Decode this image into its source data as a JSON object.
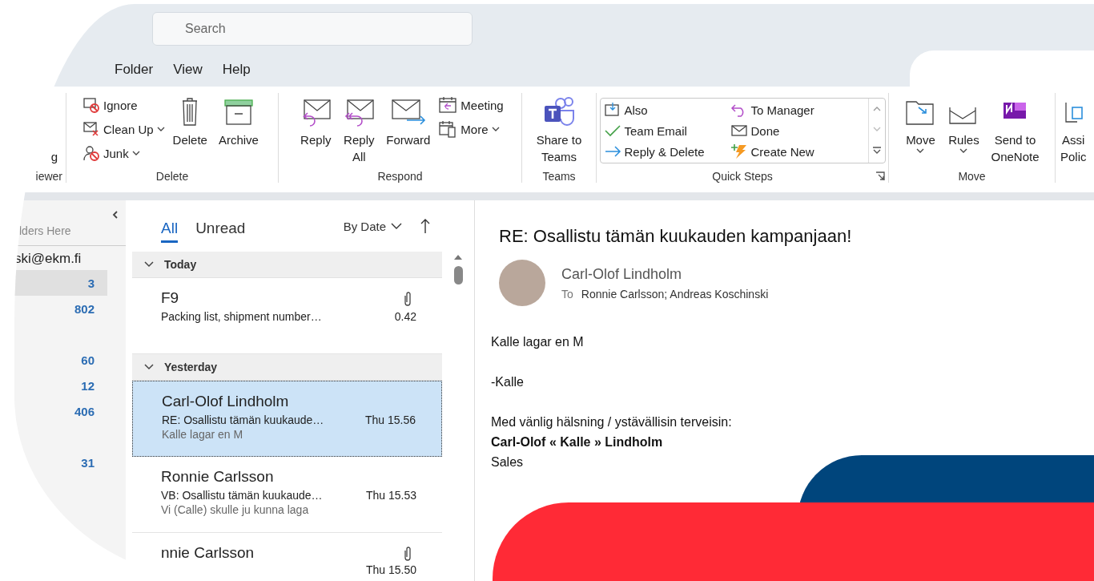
{
  "search": {
    "placeholder": "Search"
  },
  "menu": [
    {
      "label": "Folder"
    },
    {
      "label": "View"
    },
    {
      "label": "Help"
    }
  ],
  "ribbon": {
    "groups": [
      {
        "label": "iewer",
        "items": [
          {
            "kind": "stub",
            "label": "g"
          }
        ]
      },
      {
        "label": "Delete",
        "items": [
          {
            "kind": "stack",
            "items": [
              {
                "label": "Ignore",
                "dropdown": false
              },
              {
                "label": "Clean Up",
                "dropdown": true
              },
              {
                "label": "Junk",
                "dropdown": true
              }
            ]
          },
          {
            "kind": "large",
            "label": "Delete",
            "dropdown": false
          },
          {
            "kind": "large",
            "label": "Archive",
            "dropdown": false
          }
        ]
      },
      {
        "label": "Respond",
        "items": [
          {
            "kind": "large",
            "label": "Reply",
            "dropdown": false
          },
          {
            "kind": "large",
            "label": "Reply\nAll",
            "dropdown": false
          },
          {
            "kind": "large",
            "label": "Forward",
            "dropdown": false
          },
          {
            "kind": "stack",
            "items": [
              {
                "label": "Meeting",
                "dropdown": false
              },
              {
                "label": "More",
                "dropdown": true
              }
            ]
          }
        ]
      },
      {
        "label": "Teams",
        "items": [
          {
            "kind": "large",
            "label": "Share to\nTeams",
            "dropdown": false
          }
        ]
      },
      {
        "label": "Quick Steps",
        "items": [
          {
            "kind": "gallery",
            "items": [
              "Also",
              "Team Email",
              "Reply & Delete",
              "To Manager",
              "Done",
              "Create New"
            ]
          }
        ]
      },
      {
        "label": "Move",
        "items": [
          {
            "kind": "large",
            "label": "Move",
            "dropdown": true
          },
          {
            "kind": "large",
            "label": "Rules",
            "dropdown": true
          },
          {
            "kind": "large",
            "label": "Send to\nOneNote",
            "dropdown": false
          }
        ]
      },
      {
        "items": [
          {
            "kind": "large",
            "label": "Assi\nPolic",
            "dropdown": false
          }
        ]
      }
    ]
  },
  "folders": {
    "header": "lders Here",
    "account": "ski@ekm.fi",
    "items": [
      {
        "count": "3",
        "selected": true
      },
      {
        "count": "802",
        "selected": false
      },
      {
        "selected": false
      },
      {
        "count": "60",
        "selected": false
      },
      {
        "count": "12",
        "selected": false
      },
      {
        "count": "406",
        "selected": false
      },
      {
        "selected": false
      },
      {
        "count": "31",
        "selected": false
      }
    ]
  },
  "message_list": {
    "tabs": [
      {
        "label": "All",
        "selected": true
      },
      {
        "label": "Unread",
        "selected": false
      }
    ],
    "sort": "By Date",
    "groups": [
      {
        "label": "Today",
        "expanded": true,
        "messages": [
          {
            "sender": "F9",
            "subject": "Packing list, shipment number…",
            "time": "0.42",
            "attachment": true,
            "selected": false
          }
        ]
      },
      {
        "label": "Yesterday",
        "expanded": true,
        "messages": [
          {
            "sender": "Carl-Olof Lindholm",
            "subject": "RE: Osallistu tämän kuukaude…",
            "time": "Thu 15.56",
            "preview": "Kalle lagar en M",
            "attachment": false,
            "selected": true
          },
          {
            "sender": "Ronnie Carlsson",
            "subject": "VB: Osallistu tämän kuukaude…",
            "time": "Thu 15.53",
            "preview": "Vi (Calle) skulle ju kunna laga",
            "attachment": false,
            "selected": false
          },
          {
            "sender": "nnie Carlsson",
            "time": "Thu 15.50",
            "attachment": true,
            "selected": false
          }
        ]
      }
    ]
  },
  "reading_pane": {
    "subject": "RE: Osallistu tämän kuukauden kampanjaan!",
    "sender": "Carl-Olof Lindholm",
    "to_label": "To",
    "recipients": "Ronnie Carlsson; Andreas Koschinski",
    "body": [
      {
        "lines": [
          {
            "text": "Kalle lagar en M",
            "bold": false
          }
        ]
      },
      {
        "lines": [
          {
            "text": "-Kalle",
            "bold": false
          }
        ]
      },
      {
        "lines": [
          {
            "text": "Med vänlig hälsning / ystävällisin terveisin:",
            "bold": false
          },
          {
            "text": "Carl-Olof « Kalle » Lindholm",
            "bold": true
          },
          {
            "text": "Sales",
            "bold": false
          }
        ]
      }
    ]
  }
}
